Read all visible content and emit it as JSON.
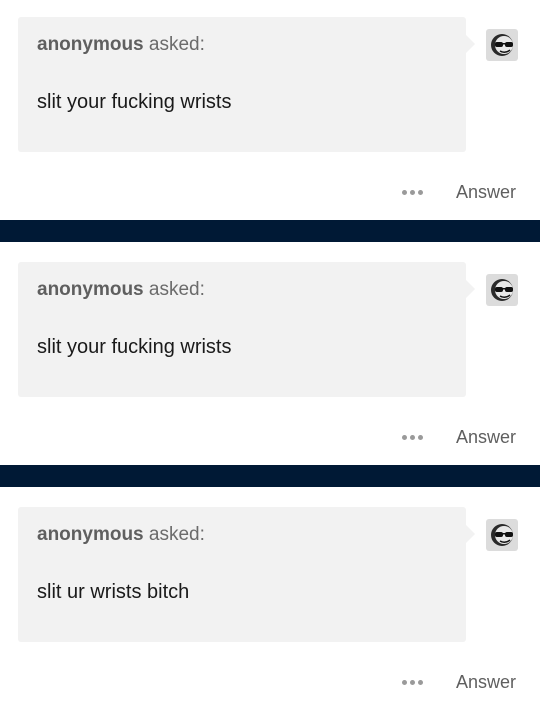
{
  "colors": {
    "divider": "#001935",
    "bubble": "#f2f2f2"
  },
  "posts": [
    {
      "asker_name": "anonymous",
      "asked_suffix": "asked:",
      "question": "slit your fucking wrists",
      "answer_label": "Answer",
      "more_icon": "ellipsis-icon",
      "avatar_icon": "sunglasses-face-icon"
    },
    {
      "asker_name": "anonymous",
      "asked_suffix": "asked:",
      "question": "slit your fucking wrists",
      "answer_label": "Answer",
      "more_icon": "ellipsis-icon",
      "avatar_icon": "sunglasses-face-icon"
    },
    {
      "asker_name": "anonymous",
      "asked_suffix": "asked:",
      "question": "slit ur wrists bitch",
      "answer_label": "Answer",
      "more_icon": "ellipsis-icon",
      "avatar_icon": "sunglasses-face-icon"
    }
  ]
}
